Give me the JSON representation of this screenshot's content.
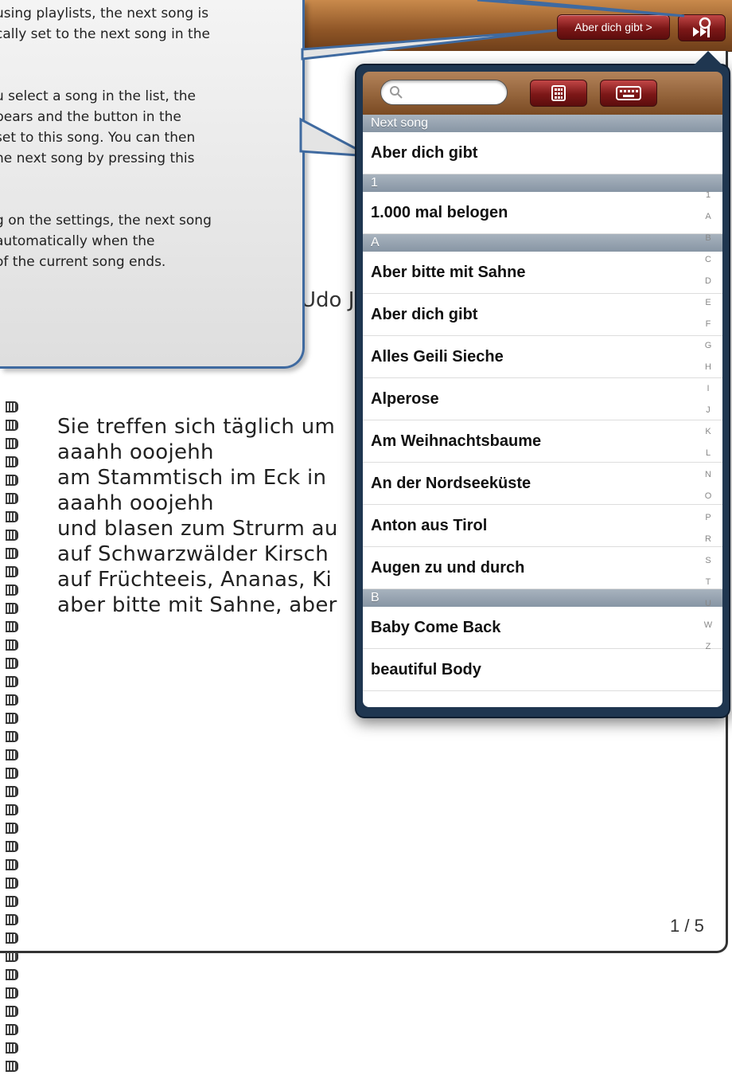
{
  "callout": {
    "lines": [
      "using playlists, the next song is",
      "cally set to the next song in the",
      "",
      "",
      "u select a song in the list, the",
      "pears and the button in the",
      " set to this song. You can then",
      "he next song by pressing this",
      "",
      "",
      "g on the settings, the next song",
      "automatically when the",
      "of the current song ends."
    ]
  },
  "toolbar": {
    "next_song_label": "Aber dich gibt >",
    "music_icon": "next-song-icon"
  },
  "song": {
    "artist_partial": "Udo J",
    "lyrics": [
      "Sie treffen sich täglich um",
      "aaahh ooojehh",
      "am Stammtisch im Eck in",
      "aaahh ooojehh",
      "und blasen zum Strurm au",
      "auf Schwarzwälder Kirsch",
      "auf Früchteeis, Ananas, Ki",
      "aber bitte mit Sahne, aber"
    ],
    "page_number": "1 / 5"
  },
  "popover": {
    "search_placeholder": "",
    "sections": [
      {
        "title": "Next song",
        "items": [
          "Aber dich gibt"
        ]
      },
      {
        "title": "1",
        "items": [
          "1.000 mal belogen"
        ]
      },
      {
        "title": "A",
        "items": [
          "Aber bitte mit Sahne",
          "Aber dich gibt",
          "Alles Geili Sieche",
          "Alperose",
          "Am Weihnachtsbaume",
          "An der Nordseeküste",
          "Anton aus Tirol",
          "Augen zu und durch"
        ]
      },
      {
        "title": "B",
        "items": [
          "Baby Come Back",
          "beautiful Body"
        ]
      }
    ],
    "index_letters": [
      "1",
      "A",
      "B",
      "C",
      "D",
      "E",
      "F",
      "G",
      "H",
      "I",
      "J",
      "K",
      "L",
      "N",
      "O",
      "P",
      "R",
      "S",
      "T",
      "U",
      "W",
      "Z"
    ]
  },
  "colors": {
    "wood": "#8e5526",
    "button_red": "#7c1717",
    "callout_border": "#3f6aa0",
    "popover_frame": "#1f3650"
  }
}
